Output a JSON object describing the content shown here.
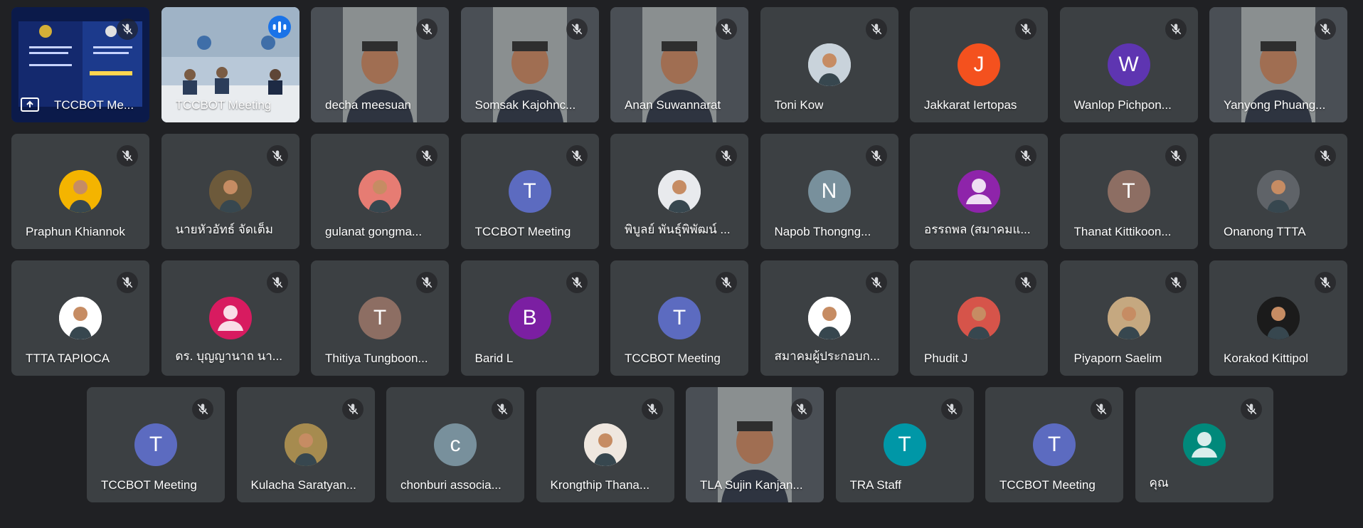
{
  "meeting": {
    "participants": [
      {
        "name": "TCCBOT Me...",
        "type": "video-presentation",
        "muted": true,
        "presenting": true
      },
      {
        "name": "TCCBOT Meeting",
        "type": "video-room",
        "muted": false,
        "speaking": true,
        "active": true
      },
      {
        "name": "decha meesuan",
        "type": "video-person",
        "muted": true
      },
      {
        "name": "Somsak Kajohnc...",
        "type": "video-person",
        "muted": true
      },
      {
        "name": "Anan Suwannarat",
        "type": "video-person",
        "muted": true
      },
      {
        "name": "Toni Kow",
        "type": "photo",
        "muted": true,
        "color": "#c9d3db"
      },
      {
        "name": "Jakkarat Iertopas",
        "type": "initial",
        "initial": "J",
        "color": "#f4511e",
        "muted": true
      },
      {
        "name": "Wanlop Pichpon...",
        "type": "initial",
        "initial": "W",
        "color": "#5e35b1",
        "muted": true
      },
      {
        "name": "Yanyong Phuang...",
        "type": "video-person",
        "muted": true
      },
      {
        "name": "Praphun Khiannok",
        "type": "photo",
        "muted": true,
        "color": "#f4b400"
      },
      {
        "name": "นายหัวอัทธ์ จัดเต็ม",
        "type": "photo",
        "muted": true,
        "color": "#6d5a3b"
      },
      {
        "name": "gulanat gongma...",
        "type": "photo",
        "muted": true,
        "color": "#e67c73"
      },
      {
        "name": "TCCBOT Meeting",
        "type": "initial",
        "initial": "T",
        "color": "#5c6bc0",
        "muted": true
      },
      {
        "name": "พิบูลย์ พันธุ์พิพัฒน์ ...",
        "type": "photo",
        "muted": true,
        "color": "#e8eaed"
      },
      {
        "name": "Napob Thongng...",
        "type": "initial",
        "initial": "N",
        "color": "#78909c",
        "muted": true
      },
      {
        "name": "อรรถพล (สมาคมแ...",
        "type": "generic",
        "color": "#8e24aa",
        "muted": true
      },
      {
        "name": "Thanat Kittikoon...",
        "type": "initial",
        "initial": "T",
        "color": "#8d6e63",
        "muted": true
      },
      {
        "name": "Onanong TTTA",
        "type": "photo",
        "muted": true,
        "color": "#5f6368"
      },
      {
        "name": "TTTA TAPIOCA",
        "type": "photo",
        "muted": true,
        "color": "#ffffff"
      },
      {
        "name": "ดร. บุญญานาถ นา...",
        "type": "generic",
        "color": "#d81b60",
        "muted": true
      },
      {
        "name": "Thitiya Tungboon...",
        "type": "initial",
        "initial": "T",
        "color": "#8d6e63",
        "muted": true
      },
      {
        "name": "Barid L",
        "type": "initial",
        "initial": "B",
        "color": "#7b1fa2",
        "muted": true
      },
      {
        "name": "TCCBOT Meeting",
        "type": "initial",
        "initial": "T",
        "color": "#5c6bc0",
        "muted": true
      },
      {
        "name": "สมาคมผู้ประกอบก...",
        "type": "photo",
        "muted": true,
        "color": "#ffffff"
      },
      {
        "name": "Phudit J",
        "type": "photo",
        "muted": true,
        "color": "#d6544a"
      },
      {
        "name": "Piyaporn Saelim",
        "type": "photo",
        "muted": true,
        "color": "#c5a880"
      },
      {
        "name": "Korakod Kittipol",
        "type": "photo",
        "muted": true,
        "color": "#1b1b1b"
      },
      {
        "name": "TCCBOT Meeting",
        "type": "initial",
        "initial": "T",
        "color": "#5c6bc0",
        "muted": true
      },
      {
        "name": "Kulacha Saratyan...",
        "type": "photo",
        "muted": true,
        "color": "#a68b4f"
      },
      {
        "name": "chonburi associa...",
        "type": "initial",
        "initial": "c",
        "color": "#78909c",
        "muted": true
      },
      {
        "name": "Krongthip Thana...",
        "type": "photo",
        "muted": true,
        "color": "#efe7df"
      },
      {
        "name": "TLA Sujin Kanjan...",
        "type": "video-person",
        "muted": true
      },
      {
        "name": "TRA Staff",
        "type": "initial",
        "initial": "T",
        "color": "#0097a7",
        "muted": true
      },
      {
        "name": "TCCBOT Meeting",
        "type": "initial",
        "initial": "T",
        "color": "#5c6bc0",
        "muted": true
      },
      {
        "name": "คุณ",
        "type": "generic",
        "color": "#00897b",
        "muted": true
      }
    ]
  }
}
